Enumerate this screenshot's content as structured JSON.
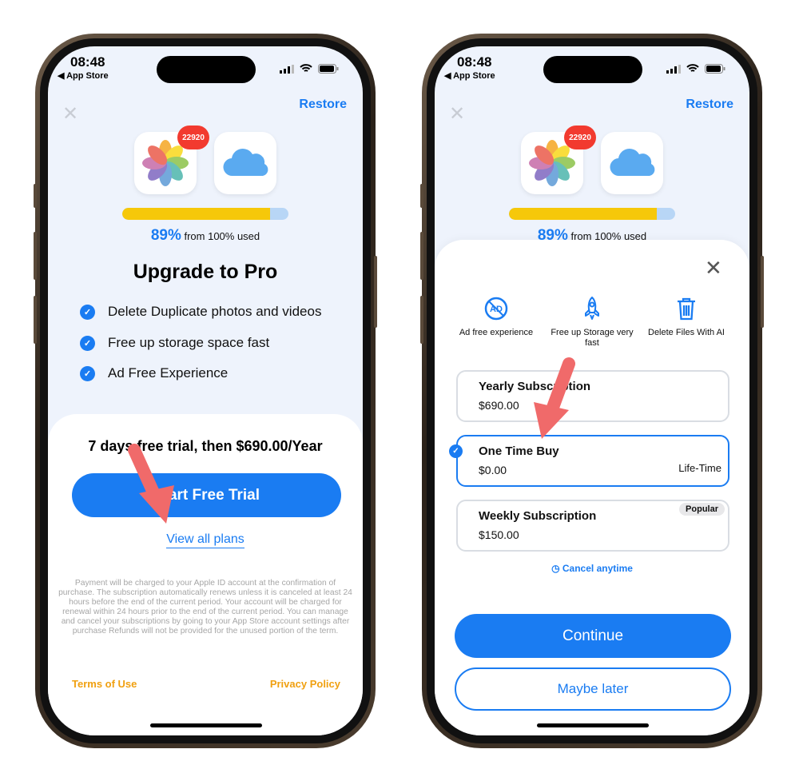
{
  "status": {
    "time": "08:48",
    "back_label": "◀ App Store"
  },
  "header": {
    "restore": "Restore",
    "photo_badge": "22920",
    "storage_used_percent": 89,
    "usage_percent": "89%",
    "usage_text": "from 100% used"
  },
  "left": {
    "title": "Upgrade to Pro",
    "features": [
      "Delete Duplicate photos and videos",
      "Free up storage space fast",
      "Ad Free Experience"
    ],
    "trial_text": "7 days free trial, then $690.00/Year",
    "cta": "Start Free Trial",
    "view_plans": "View all plans",
    "legal": "Payment will be charged to your Apple ID account at the confirmation of purchase. The subscription automatically renews unless it is canceled at least 24 hours before the end of the current period. Your account will be charged for renewal within 24 hours prior to the end of the current period. You can manage and cancel your subscriptions by going to your App Store account settings after purchase Refunds will not be provided for the unused portion of the term.",
    "terms": "Terms of Use",
    "privacy": "Privacy Policy"
  },
  "right": {
    "benefits": [
      {
        "label": "Ad free experience",
        "icon": "ad-block-icon"
      },
      {
        "label": "Free up Storage very fast",
        "icon": "rocket-icon"
      },
      {
        "label": "Delete Files With AI",
        "icon": "trash-icon"
      }
    ],
    "plans": [
      {
        "name": "Yearly Subscription",
        "price": "$690.00",
        "tag": "",
        "selected": false
      },
      {
        "name": "One Time Buy",
        "price": "$0.00",
        "tag": "Life-Time",
        "selected": true
      },
      {
        "name": "Weekly Subscription",
        "price": "$150.00",
        "tag": "Popular",
        "selected": false
      }
    ],
    "cancel": "Cancel anytime",
    "continue": "Continue",
    "later": "Maybe later"
  },
  "colors": {
    "accent": "#1a7cf2",
    "bar_fill": "#f6c80a",
    "links": "#f0a010",
    "annotation_arrow": "#f06a6a"
  }
}
